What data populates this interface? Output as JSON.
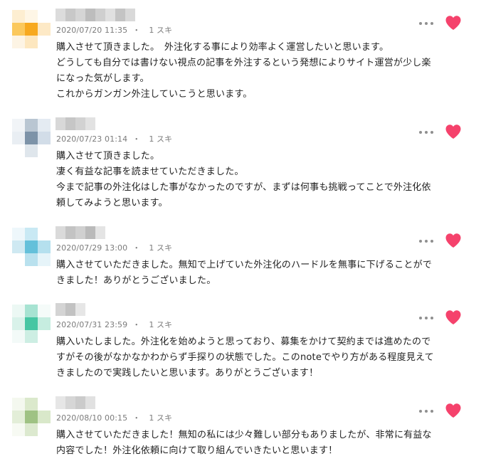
{
  "comments": [
    {
      "date": "2020/07/20 11:35",
      "sep": "・",
      "likes": "1 スキ",
      "lines": [
        "購入させて頂きました。　外注化する事により効率よく運営したいと思います。",
        "どうしても自分では書けない視点の記事を外注するという発想によりサイト運営が少し楽",
        "になった気がします。",
        "これからガンガン外注していこうと思います。"
      ],
      "avatar_colors": [
        "#fdeed1",
        "#fef6e6",
        "#ffffff",
        "#fbc85c",
        "#f7a91f",
        "#fde9c6",
        "#fdf4e4",
        "#fde7bf",
        "#ffffff"
      ],
      "name_colors": [
        "#dcdcdc",
        "#c8c8c8",
        "#d5d5d5",
        "#bdbdbd",
        "#cfcfcf",
        "#e0e0e0",
        "#c4c4c4",
        "#d9d9d9"
      ]
    },
    {
      "date": "2020/07/23 01:14",
      "sep": "・",
      "likes": "1 スキ",
      "lines": [
        "購入させて頂きました。",
        "凄く有益な記事を読ませていただきました。",
        "今まで記事の外注化はした事がなかったのですが、まずは何事も挑戦ってことで外注化依",
        "頼してみようと思います。"
      ],
      "avatar_colors": [
        "#f1f4f7",
        "#b9c6d2",
        "#e4ebf2",
        "#e9eef3",
        "#7d93a8",
        "#d2dde8",
        "#ffffff",
        "#dfe6ec",
        "#ffffff"
      ],
      "name_colors": [
        "#d8d8d8",
        "#c6c6c6",
        "#d2d2d2",
        "#e2e2e2"
      ]
    },
    {
      "date": "2020/07/29 13:00",
      "sep": "・",
      "likes": "1 スキ",
      "lines": [
        "購入させていただきました。無知で上げていた外注化のハードルを無事に下げることがで",
        "きました！ありがとうございました。"
      ],
      "avatar_colors": [
        "#eef7fb",
        "#c9e9f4",
        "#ffffff",
        "#cfe9f2",
        "#64c0da",
        "#b5e0ee",
        "#ffffff",
        "#b9e1ee",
        "#e6f4f9"
      ],
      "name_colors": [
        "#dadada",
        "#c3c3c3",
        "#d0d0d0",
        "#bababa",
        "#e4e4e4"
      ]
    },
    {
      "date": "2020/07/31 23:59",
      "sep": "・",
      "likes": "1 スキ",
      "lines": [
        "購入いたしました。外注化を始めようと思っており、募集をかけて契約までは進めたので",
        "すがその後がなかなかわからず手探りの状態でした。このnoteでやり方がある程度見えて",
        "きましたので実践したいと思います。ありがとうございます！"
      ],
      "avatar_colors": [
        "#ecf8f4",
        "#a7e3d2",
        "#f5fbf9",
        "#d9f2ea",
        "#46c6a3",
        "#c6ede0",
        "#f3faf8",
        "#cdeee3",
        "#ffffff"
      ],
      "name_colors": [
        "#d4d4d4",
        "#c2c2c2",
        "#e6e6e6"
      ]
    },
    {
      "date": "2020/08/10 00:15",
      "sep": "・",
      "likes": "1 スキ",
      "lines": [
        "購入させていただきました！無知の私には少々難しい部分もありましたが、非常に有益な",
        "内容でした！外注化依頼に向けて取り組んでいきたいと思います！"
      ],
      "avatar_colors": [
        "#f4f8ef",
        "#dbe9cc",
        "#ffffff",
        "#e3eed8",
        "#9fc284",
        "#d9e8ca",
        "#f7faf3",
        "#dce9cf",
        "#ffffff"
      ],
      "name_colors": [
        "#e6e6e6",
        "#d6d6d6",
        "#cbcbcb",
        "#e1e1e1"
      ]
    }
  ],
  "icons": {
    "more": "more-dots-icon",
    "like": "heart-icon"
  },
  "colors": {
    "heart": "#f5426c",
    "meta_text": "#7b7b7b",
    "body_text": "#222222"
  }
}
